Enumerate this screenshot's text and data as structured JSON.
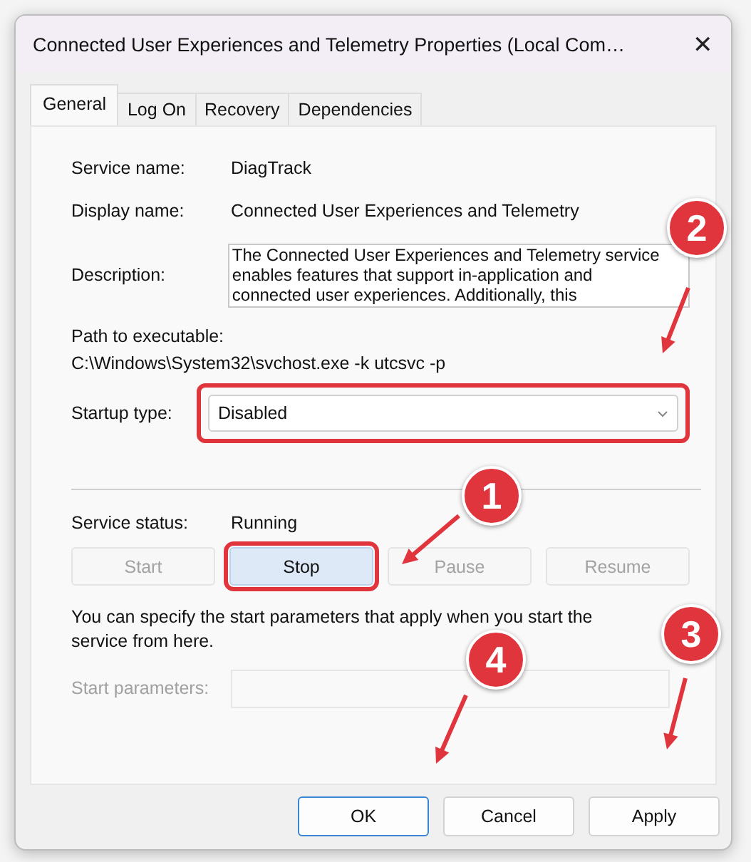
{
  "window": {
    "title": "Connected User Experiences and Telemetry Properties (Local Com…",
    "close": "✕"
  },
  "tabs": [
    {
      "label": "General",
      "selected": true
    },
    {
      "label": "Log On",
      "selected": false
    },
    {
      "label": "Recovery",
      "selected": false
    },
    {
      "label": "Dependencies",
      "selected": false
    }
  ],
  "fields": [
    {
      "label": "Service name:",
      "value": "DiagTrack"
    },
    {
      "label": "Display name:",
      "value": "Connected User Experiences and Telemetry"
    }
  ],
  "description": {
    "label": "Description:",
    "value": "The Connected User Experiences and Telemetry service enables features that support in-application and connected user experiences. Additionally, this"
  },
  "path": {
    "label": "Path to executable:",
    "value": "C:\\Windows\\System32\\svchost.exe -k utcsvc -p"
  },
  "startup": {
    "label": "Startup type:",
    "value": "Disabled",
    "highlighted": true
  },
  "status": {
    "label": "Service status:",
    "value": "Running"
  },
  "service_buttons": [
    {
      "label": "Start",
      "disabled": true,
      "highlighted": false
    },
    {
      "label": "Stop",
      "disabled": false,
      "highlighted": true
    },
    {
      "label": "Pause",
      "disabled": true,
      "highlighted": false
    },
    {
      "label": "Resume",
      "disabled": true,
      "highlighted": false
    }
  ],
  "hint": "You can specify the start parameters that apply when you start the service from here.",
  "start_parameters": {
    "label": "Start parameters:",
    "disabled": true
  },
  "dialog_buttons": [
    {
      "label": "OK",
      "default": true
    },
    {
      "label": "Cancel",
      "default": false
    },
    {
      "label": "Apply",
      "default": false
    }
  ],
  "annotations": [
    {
      "number": "2"
    },
    {
      "number": "1"
    },
    {
      "number": "4"
    },
    {
      "number": "3"
    }
  ]
}
